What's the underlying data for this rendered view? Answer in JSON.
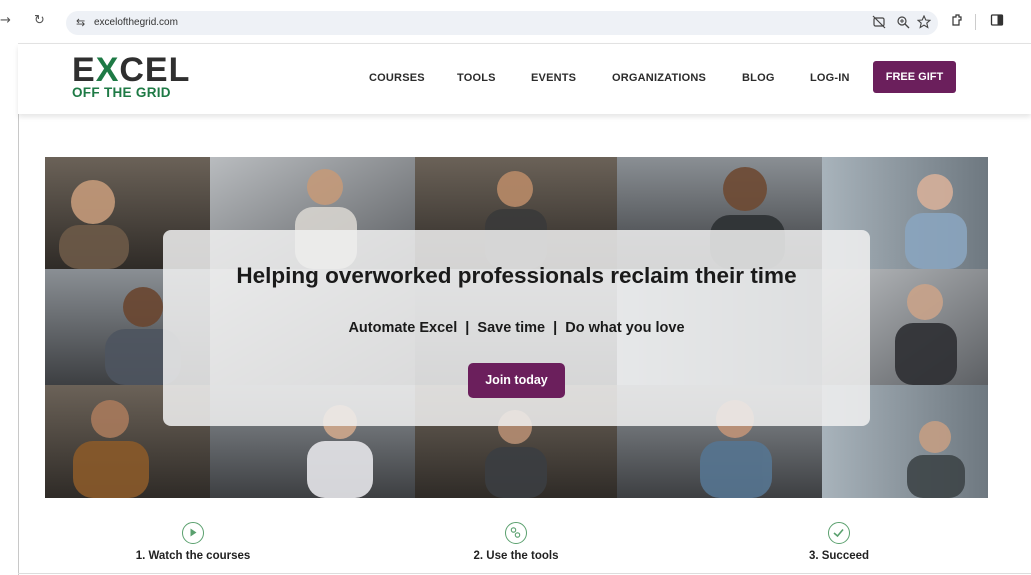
{
  "browser": {
    "back_glyph": "→",
    "reload_glyph": "↻",
    "site_info_glyph": "⇆",
    "url": "excelofthegrid.com",
    "url_icons": [
      "eye-off-icon",
      "zoom-icon",
      "star-icon"
    ],
    "toolbar_icons": [
      "extensions-icon",
      "sidebar-icon"
    ]
  },
  "site": {
    "logo": {
      "word_pre": "E",
      "word_x": "X",
      "word_post": "CEL",
      "tagline": "OFF THE GRID"
    },
    "nav": [
      "COURSES",
      "TOOLS",
      "EVENTS",
      "ORGANIZATIONS",
      "BLOG",
      "LOG-IN"
    ],
    "cta": "FREE GIFT",
    "colors": {
      "brand_purple": "#6b1f5c",
      "brand_green": "#1e7a45"
    }
  },
  "hero": {
    "title": "Helping overworked professionals reclaim their time",
    "subtitle": "Automate Excel  |  Save time  |  Do what you love",
    "button": "Join today"
  },
  "steps": [
    {
      "label": "1. Watch the courses",
      "icon": "play-icon"
    },
    {
      "label": "2. Use the tools",
      "icon": "tools-icon"
    },
    {
      "label": "3. Succeed",
      "icon": "check-icon"
    }
  ]
}
